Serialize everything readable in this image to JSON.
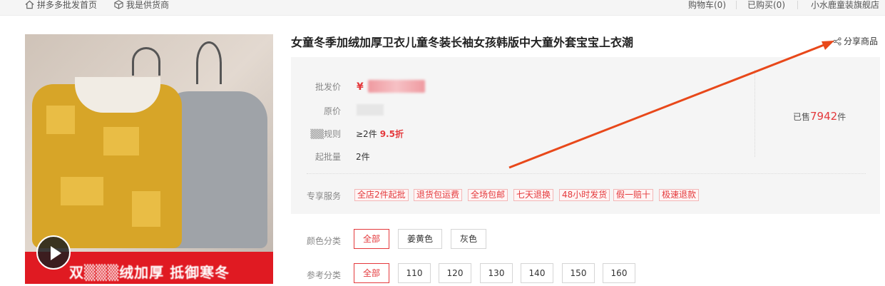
{
  "topbar": {
    "home_label": "拼多多批发首页",
    "supplier_label": "我是供货商",
    "cart_label": "购物车(0)",
    "bought_label": "已购买(0)",
    "shop_label": "小水鹿童装旗舰店"
  },
  "product": {
    "title": "女童冬季加绒加厚卫衣儿童冬装长袖女孩韩版中大童外套宝宝上衣潮",
    "share_label": "分享商品",
    "banner_text": "双▒▒▒绒加厚 抵御寒冬",
    "price_label": "批发价",
    "price_symbol": "¥",
    "original_price_label": "原价",
    "discount_rule_label": "▒▒规则",
    "discount_condition": "≥2件",
    "discount_value": "9.5折",
    "min_order_label": "起批量",
    "min_order_value": "2件",
    "sold_prefix": "已售",
    "sold_count": "7942",
    "sold_suffix": "件",
    "services_label": "专享服务",
    "services": [
      "全店2件起批",
      "退货包运费",
      "全场包邮",
      "七天退换",
      "48小时发货",
      "假一赔十",
      "极速退款"
    ]
  },
  "color_filter": {
    "label": "颜色分类",
    "options": [
      "全部",
      "姜黄色",
      "灰色"
    ],
    "selected": "全部"
  },
  "size_filter": {
    "label": "参考分类",
    "options": [
      "全部",
      "110",
      "120",
      "130",
      "140",
      "150",
      "160"
    ],
    "selected": "全部"
  },
  "colors": {
    "accent": "#e4393c",
    "annotation_arrow": "#e8481a"
  }
}
